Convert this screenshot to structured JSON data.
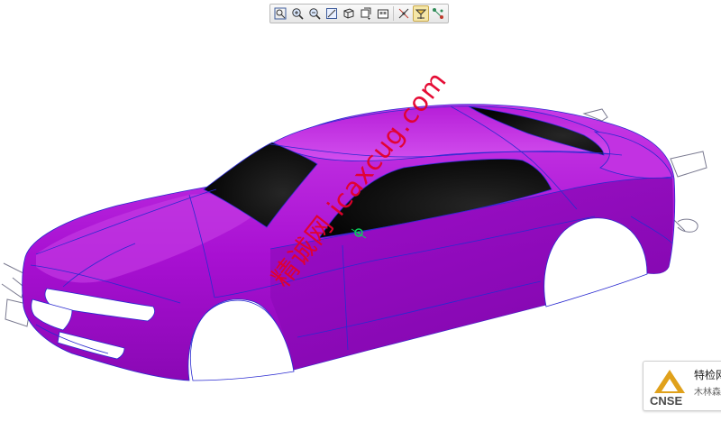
{
  "toolbar": {
    "buttons": [
      {
        "name": "refit-icon"
      },
      {
        "name": "zoom-in-icon"
      },
      {
        "name": "zoom-out-icon"
      },
      {
        "name": "repaint-icon"
      },
      {
        "name": "display-style-icon"
      },
      {
        "name": "saved-orientations-icon"
      },
      {
        "name": "view-manager-icon"
      },
      {
        "name": "datum-display-icon"
      },
      {
        "name": "spin-center-icon",
        "active": true
      },
      {
        "name": "points-display-icon"
      }
    ]
  },
  "model": {
    "body_color": "#b10fd6",
    "glass_color": "#0b0b0b",
    "edge_color": "#2a2ad0"
  },
  "watermark": {
    "text": "精诚网 icaxcug.com",
    "color": "#e4002b"
  },
  "badge": {
    "logo_text": "CNSE",
    "title": "特检网",
    "subtitle": "木林森"
  }
}
